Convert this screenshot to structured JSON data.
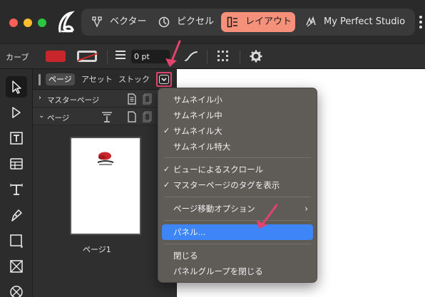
{
  "titlebar": {
    "personas": [
      {
        "label": "ベクター",
        "icon": "vector-persona-icon"
      },
      {
        "label": "ピクセル",
        "icon": "pixel-persona-icon"
      },
      {
        "label": "レイアウト",
        "icon": "layout-persona-icon",
        "active": true
      },
      {
        "label": "My Perfect Studio",
        "icon": "studio-icon"
      }
    ]
  },
  "context_toolbar": {
    "label": "カーブ",
    "fill_color": "#c8262a",
    "stroke_color": "#d6d6d6",
    "stroke_width": "0 pt"
  },
  "panel": {
    "tabs": [
      {
        "label": "ページ",
        "active": true
      },
      {
        "label": "アセット"
      },
      {
        "label": "ストック"
      }
    ],
    "sections": [
      {
        "label": "マスターページ",
        "expanded": false
      },
      {
        "label": "ページ",
        "expanded": true
      }
    ],
    "page_thumbnail_label": "ページ1"
  },
  "menu": {
    "items": [
      {
        "label": "サムネイル小",
        "checked": false
      },
      {
        "label": "サムネイル中",
        "checked": false
      },
      {
        "label": "サムネイル大",
        "checked": true
      },
      {
        "label": "サムネイル特大",
        "checked": false
      },
      {
        "label": "ビューによるスクロール",
        "checked": true
      },
      {
        "label": "マスターページのタグを表示",
        "checked": true
      },
      {
        "label": "ページ移動オプション",
        "submenu": true
      },
      {
        "label": "パネル...",
        "highlighted": true
      },
      {
        "label": "閉じる"
      },
      {
        "label": "パネルグループを閉じる"
      }
    ]
  },
  "colors": {
    "accent": "#f5907a",
    "highlight": "#3e86f7",
    "annotation": "#e2436d"
  }
}
